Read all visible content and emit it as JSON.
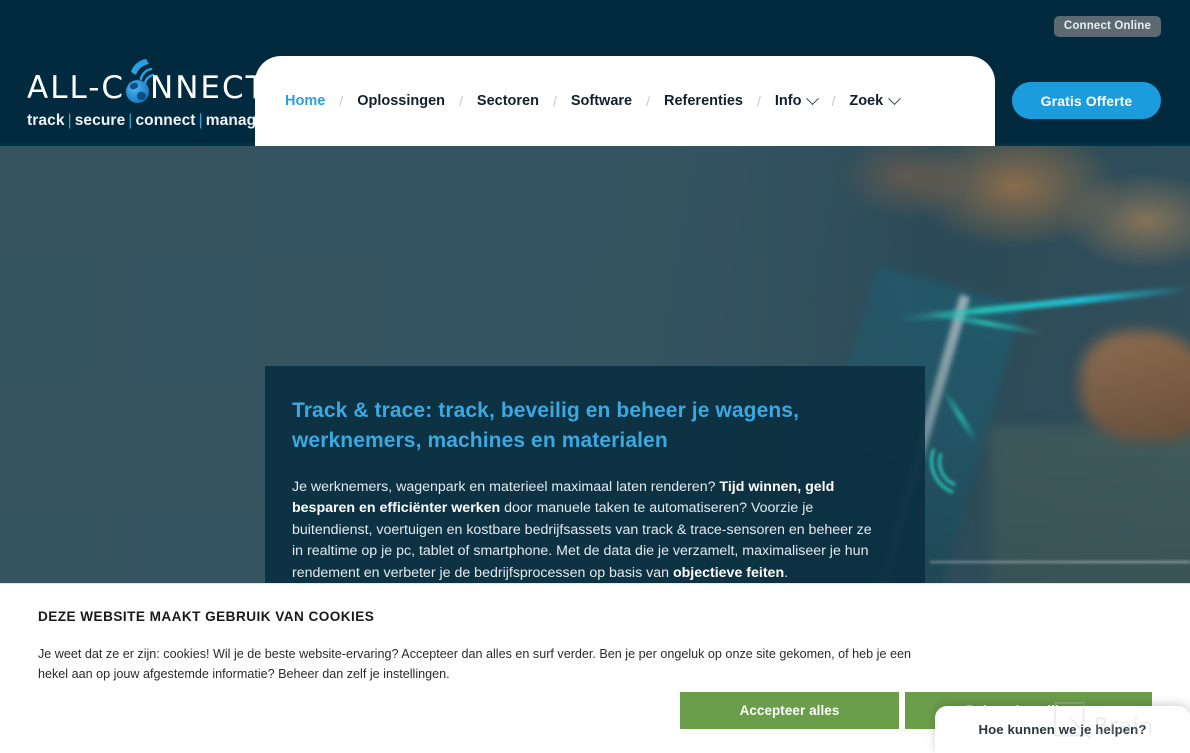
{
  "header": {
    "connect_online_label": "Connect Online",
    "cta_label": "Gratis Offerte",
    "logo": {
      "word_pre": "ALL-C",
      "word_post": "NNECTS",
      "tagline_1": "track",
      "tagline_2": "secure",
      "tagline_3": "connect",
      "tagline_4": "manage",
      "separator": "|"
    },
    "nav": {
      "separator": "/",
      "items": [
        {
          "label": "Home",
          "active": true,
          "dropdown": false
        },
        {
          "label": "Oplossingen",
          "active": false,
          "dropdown": false
        },
        {
          "label": "Sectoren",
          "active": false,
          "dropdown": false
        },
        {
          "label": "Software",
          "active": false,
          "dropdown": false
        },
        {
          "label": "Referenties",
          "active": false,
          "dropdown": false
        },
        {
          "label": "Info",
          "active": false,
          "dropdown": true
        },
        {
          "label": "Zoek",
          "active": false,
          "dropdown": true
        }
      ]
    }
  },
  "hero": {
    "title": "Track & trace: track, beveilig en beheer je wagens, werknemers, machines en materialen",
    "body_part_1": "Je werknemers, wagenpark en materieel maximaal laten renderen? ",
    "body_bold_1": "Tijd winnen, geld besparen en efficiënter werken",
    "body_part_2": " door manuele taken te automatiseren? Voorzie je buitendienst, voertuigen en kostbare bedrijfsassets van track & trace-sensoren en beheer ze in realtime op je pc, tablet of smartphone. Met de data die je verzamelt, maximaliseer je hun rendement en verbeter je de bedrijfsprocessen op basis van ",
    "body_bold_2": "objectieve feiten",
    "body_part_3": "."
  },
  "cookie_banner": {
    "title": "DEZE WEBSITE MAAKT GEBRUIK VAN COOKIES",
    "text": "Je weet dat ze er zijn: cookies! Wil je de beste website-ervaring? Accepteer dan alles en surf verder. Ben je per ongeluk op onze site gekomen, of heb je een hekel aan op jouw afgestemde informatie? Beheer dan zelf je instellingen.",
    "accept_label": "Accepteer alles",
    "manage_label": "Beheer instellingen"
  },
  "chat_widget": {
    "label": "Hoe kunnen we je helpen?"
  },
  "watermark": {
    "text": "Brain"
  },
  "colors": {
    "header_bg": "#012a3e",
    "accent_blue": "#2c9fe0",
    "cta_blue": "#1b9ddd",
    "hero_card_bg": "#0b2f41",
    "hero_title": "#3ba8e0",
    "cookie_button_green": "#6b9e4b",
    "connect_pill": "#5b6a72"
  }
}
